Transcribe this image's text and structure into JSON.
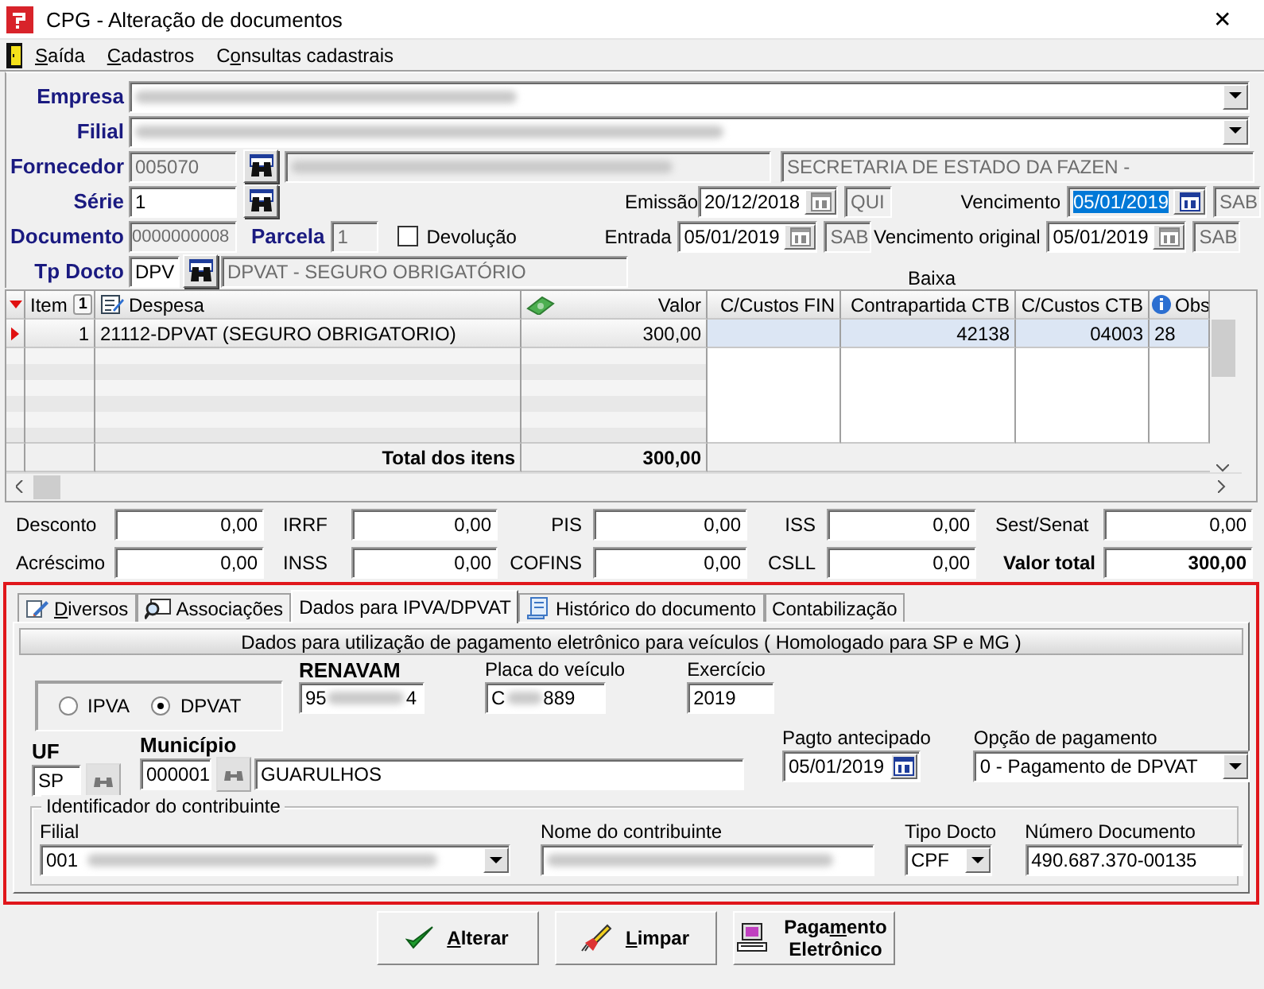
{
  "window": {
    "title": "CPG - Alteração de documentos",
    "close": "✕"
  },
  "menu": [
    {
      "parts": {
        "underlined": "S",
        "after": "aída"
      }
    },
    {
      "parts": {
        "underlined": "C",
        "after": "adastros"
      }
    },
    {
      "parts": {
        "before": "C",
        "underlined": "o",
        "after": "nsultas cadastrais"
      }
    }
  ],
  "header": {
    "empresa": {
      "label": "Empresa"
    },
    "filial": {
      "label": "Filial"
    },
    "fornecedor": {
      "label": "Fornecedor",
      "code": "005070",
      "name": "SECRETARIA DE ESTADO DA FAZEN -"
    },
    "serie": {
      "label": "Série",
      "value": "1"
    },
    "documento": {
      "label": "Documento",
      "value": "0000000008"
    },
    "parcela": {
      "label": "Parcela",
      "value": "1"
    },
    "devolucao": {
      "label": "Devolução",
      "checked": false
    },
    "tp_docto": {
      "label": "Tp Docto",
      "code": "DPV",
      "description": "DPVAT - SEGURO OBRIGATÓRIO"
    },
    "dates": [
      {
        "label": "Emissão",
        "value": "20/12/2018",
        "day": "QUI",
        "selected": false
      },
      {
        "label": "Vencimento",
        "value": "05/01/2019",
        "day": "SAB",
        "selected": true
      },
      {
        "label": "Entrada",
        "value": "05/01/2019",
        "day": "SAB",
        "selected": false
      },
      {
        "label": "Vencimento original",
        "value": "05/01/2019",
        "day": "SAB",
        "selected": false
      }
    ],
    "baixa": "Baixa"
  },
  "grid": {
    "columns": [
      {
        "label": "Item",
        "sort": "1"
      },
      {
        "label": "Despesa"
      },
      {
        "label": "Valor"
      },
      {
        "label": "C/Custos FIN"
      },
      {
        "label": "Contrapartida CTB"
      },
      {
        "label": "C/Custos CTB"
      },
      {
        "label": "Obs"
      }
    ],
    "rows": [
      {
        "item": "1",
        "despesa": "21112-DPVAT (SEGURO OBRIGATORIO)",
        "valor": "300,00",
        "contrapartida_ctb": "42138",
        "c_custos_ctb": "04003",
        "obs": "28",
        "selected": true
      }
    ],
    "total": {
      "label": "Total dos itens",
      "value": "300,00"
    }
  },
  "totals": [
    {
      "label": "Desconto",
      "value": "0,00",
      "emphasis": false
    },
    {
      "label": "IRRF",
      "value": "0,00",
      "emphasis": false
    },
    {
      "label": "PIS",
      "value": "0,00",
      "emphasis": false
    },
    {
      "label": "ISS",
      "value": "0,00",
      "emphasis": false
    },
    {
      "label": "Sest/Senat",
      "value": "0,00",
      "emphasis": false
    },
    {
      "label": "Acréscimo",
      "value": "0,00",
      "emphasis": false
    },
    {
      "label": "INSS",
      "value": "0,00",
      "emphasis": false
    },
    {
      "label": "COFINS",
      "value": "0,00",
      "emphasis": false
    },
    {
      "label": "CSLL",
      "value": "0,00",
      "emphasis": false
    },
    {
      "label": "Valor total",
      "value": "300,00",
      "emphasis": true
    }
  ],
  "tabs": [
    {
      "parts": {
        "underlined": "D",
        "after": "iversos"
      },
      "selected": false
    },
    {
      "parts": {
        "before": "Associações"
      },
      "selected": false
    },
    {
      "parts": {
        "before": "Dados para IPVA/DPVAT"
      },
      "selected": true
    },
    {
      "parts": {
        "before": "Histórico do documento"
      },
      "selected": false
    },
    {
      "parts": {
        "before": "Contabilização"
      },
      "selected": false
    }
  ],
  "ipva": {
    "title": "Dados para utilização de pagamento eletrônico para veículos ( Homologado para  SP e MG )",
    "tipo": [
      {
        "label": "IPVA",
        "selected": false
      },
      {
        "label": "DPVAT",
        "selected": true
      }
    ],
    "renavam": {
      "label": "RENAVAM",
      "visible": [
        "95",
        "4"
      ]
    },
    "placa": {
      "label": "Placa do veículo",
      "visible": [
        "C",
        "889"
      ]
    },
    "exercicio": {
      "label": "Exercício",
      "value": "2019"
    },
    "uf": {
      "label": "UF",
      "value": "SP"
    },
    "municipio": {
      "label": "Município",
      "code": "000001",
      "name": "GUARULHOS"
    },
    "pagto_antecipado": {
      "label": "Pagto antecipado",
      "value": "05/01/2019"
    },
    "opcao_pagamento": {
      "label": "Opção de pagamento",
      "value": "0 - Pagamento de DPVAT"
    },
    "identificador": {
      "legend": "Identificador do contribuinte",
      "filial": {
        "label": "Filial",
        "value": "001"
      },
      "nome": {
        "label": "Nome do contribuinte"
      },
      "tipo_docto": {
        "label": "Tipo Docto",
        "value": "CPF"
      },
      "numero": {
        "label": "Número Documento",
        "value": "490.687.370-00135"
      }
    }
  },
  "buttons": [
    {
      "kind": "alterar",
      "parts": {
        "underlined": "A",
        "after": "lterar"
      }
    },
    {
      "kind": "limpar",
      "parts": {
        "underlined": "L",
        "after": "impar"
      }
    },
    {
      "kind": "pagamento",
      "parts": {
        "before": "Paga",
        "underlined": "m",
        "after": "ento Eletrônico"
      }
    }
  ]
}
